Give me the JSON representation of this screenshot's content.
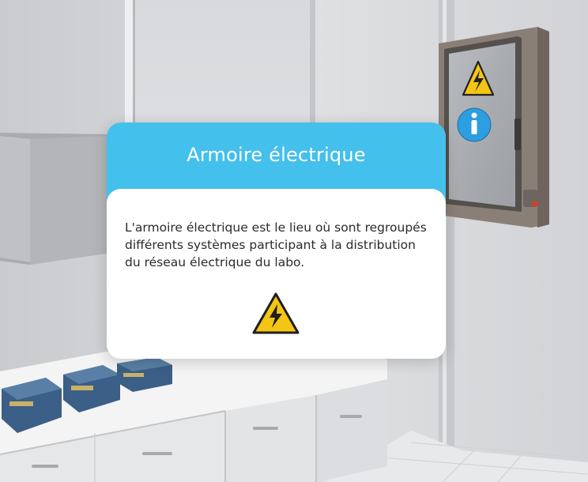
{
  "dialog": {
    "title": "Armoire électrique",
    "text": "L'armoire électrique est le lieu où sont regroupés différents systèmes participant à la distribution du réseau électrique du labo."
  },
  "icons": [
    "warning-electric-icon",
    "info-icon"
  ],
  "colors": {
    "header": "#43c0ec",
    "warning": "#f4c514",
    "info": "#2d9ee0"
  }
}
